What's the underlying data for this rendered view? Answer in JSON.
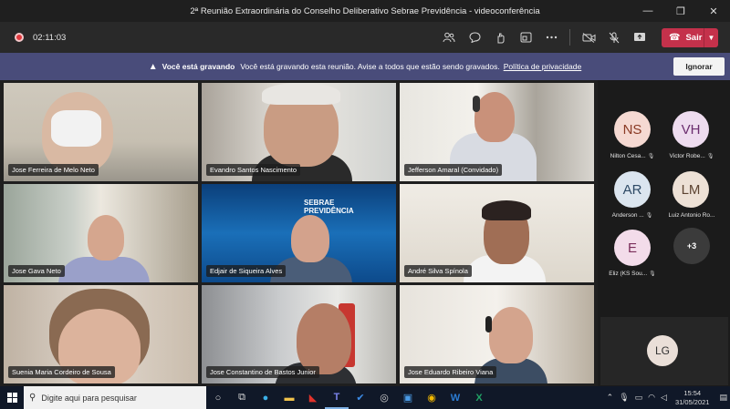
{
  "window": {
    "title": "2ª Reunião Extraordinária do Conselho Deliberativo Sebrae Previdência - videoconferência",
    "controls": [
      "—",
      "❐",
      "✕"
    ]
  },
  "toolbar": {
    "timer": "02:11:03",
    "leave_label": "Sair"
  },
  "banner": {
    "bold": "Você está gravando",
    "text": "Você está gravando esta reunião. Avise a todos que estão sendo gravados.",
    "link": "Política de privacidade",
    "ignore_label": "Ignorar"
  },
  "participants": [
    {
      "name": "Jose Ferreira de Melo Neto",
      "speaking": true
    },
    {
      "name": "Evandro Santos Nascimento",
      "speaking": false
    },
    {
      "name": "Jefferson Amaral (Convidado)",
      "speaking": false
    },
    {
      "name": "Jose Gava Neto",
      "speaking": false
    },
    {
      "name": "Edjair de Siqueira Alves",
      "speaking": false
    },
    {
      "name": "André Silva Spínola",
      "speaking": false
    },
    {
      "name": "Suenia Maria Cordeiro de Sousa",
      "speaking": true
    },
    {
      "name": "Jose Constantino de Bastos Junior",
      "speaking": true
    },
    {
      "name": "Jose Eduardo Ribeiro Viana",
      "speaking": false
    }
  ],
  "logo_text": "SEBRAE PREVIDÊNCIA",
  "side_participants": [
    {
      "initials": "NS",
      "name": "Nilton Cesa...",
      "color": "#f5d9d2",
      "text_color": "#8a3a24"
    },
    {
      "initials": "VH",
      "name": "Victor Robe...",
      "color": "#eedcef",
      "text_color": "#6b2e6f"
    },
    {
      "initials": "AR",
      "name": "Anderson ...",
      "color": "#dbe5ef",
      "text_color": "#2e4a66"
    },
    {
      "initials": "LM",
      "name": "Luiz Antonio Ro...",
      "color": "#ede1d6",
      "text_color": "#5d4432"
    },
    {
      "initials": "E",
      "name": "Eliz (KS Sou...",
      "color": "#f3dcea",
      "text_color": "#7a2d5a"
    }
  ],
  "more_count": "+3",
  "self_initials": "LG",
  "taskbar": {
    "search_placeholder": "Digite aqui para pesquisar",
    "time": "15:54",
    "date": "31/05/2021"
  }
}
